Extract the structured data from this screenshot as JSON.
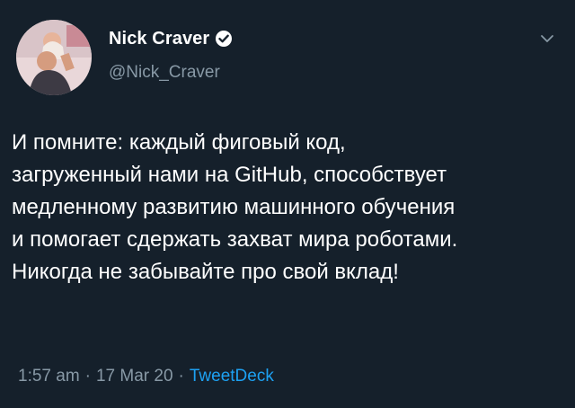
{
  "author": {
    "display_name": "Nick Craver",
    "handle": "@Nick_Craver",
    "verified": true,
    "avatar_icon": "profile-photo"
  },
  "tweet": {
    "text": "И помните: каждый фиговый код,\nзагруженный нами на GitHub, способствует\nмедленному развитию машинного обучения\nи помогает сдержать захват мира роботами.\nНикогда не забывайте про свой вклад!"
  },
  "meta": {
    "time": "1:57 am",
    "separator": "·",
    "date": "17 Mar 20",
    "source": "TweetDeck"
  },
  "colors": {
    "background": "#15202b",
    "text": "#ffffff",
    "muted": "#8899a6",
    "accent": "#1da1f2"
  },
  "icons": {
    "verified": "verified-badge-icon",
    "menu": "chevron-down-icon"
  }
}
